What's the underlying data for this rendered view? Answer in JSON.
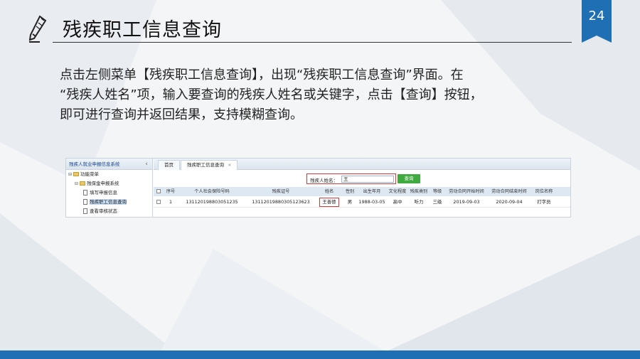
{
  "slide": {
    "title": "残疾职工信息查询",
    "page_number": "24",
    "description_lines": [
      "点击左侧菜单【残疾职工信息查询】，出现“残疾职工信息查询”界面。在",
      "“残疾人姓名”项，输入要查询的残疾人姓名或关键字，点击【查询】按钮，",
      "即可进行查询并返回结果，支持模糊查询。"
    ],
    "accent_color": "#1f6fb5",
    "highlight_color": "#d23b3b"
  },
  "app": {
    "system_title": "残疾人就业申报信息系统",
    "tree": [
      {
        "label": "功能菜单",
        "level": 0,
        "toggle": "⊟",
        "type": "folder"
      },
      {
        "label": "残保金申报系统",
        "level": 1,
        "toggle": "⊟",
        "type": "folder"
      },
      {
        "label": "填写申报信息",
        "level": 2,
        "type": "doc"
      },
      {
        "label": "残疾职工信息查询",
        "level": 2,
        "type": "doc",
        "selected": true
      },
      {
        "label": "查看审核状态",
        "level": 2,
        "type": "doc"
      }
    ],
    "tabs": [
      {
        "label": "首页"
      },
      {
        "label": "残疾职工信息查询",
        "close": "×"
      }
    ],
    "search": {
      "label": "残疾人姓名：",
      "value": "王",
      "button": "查询"
    },
    "grid": {
      "columns": [
        "序号",
        "个人社会保险号码",
        "残疾证号",
        "姓名",
        "性别",
        "出生年月",
        "文化程度",
        "残疾类别",
        "等级",
        "劳动合同开始时间",
        "劳动合同结束时间",
        "岗位名称"
      ],
      "rows": [
        [
          "1",
          "131120198803051235",
          "13112019880305123623",
          "王善德",
          "男",
          "1988-03-05",
          "高中",
          "听力",
          "三级",
          "2019-09-03",
          "2020-09-04",
          "打字员"
        ]
      ]
    }
  }
}
